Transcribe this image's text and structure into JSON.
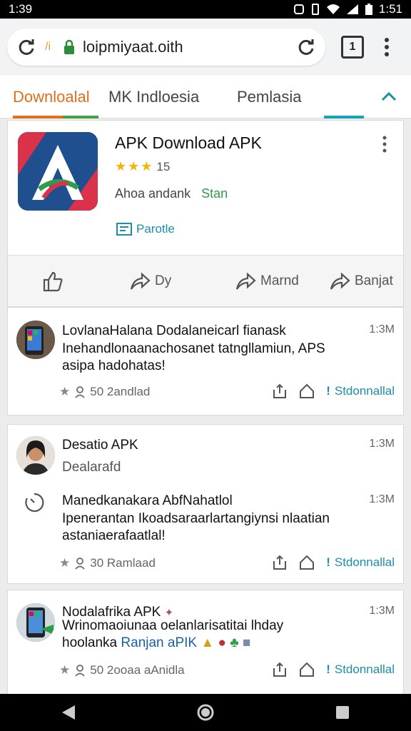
{
  "status_bar": {
    "time_left": "1:39",
    "time_right": "1:51"
  },
  "browser": {
    "url": "loipmiyaat.oith",
    "tab_count": "1",
    "lock_label": "/i"
  },
  "tabs": [
    {
      "label": "Downloalal"
    },
    {
      "label": "MK Indloesia"
    },
    {
      "label": "Pemlasia"
    }
  ],
  "app_card": {
    "title": "APK Download APK",
    "rating": "15",
    "subtitle": "Ahoa andank",
    "subtitle_status": "Stan",
    "badge_label": "Parotle",
    "actions": [
      {
        "label": ""
      },
      {
        "label": "Dy"
      },
      {
        "label": "Marnd"
      },
      {
        "label": "Banjat"
      }
    ]
  },
  "posts": [
    {
      "title": "LovlanaHalana Dodalaneicarl fianask",
      "body_lines": [
        "Inehandlonaanachosanet tatngllamiun, APS",
        "asipa hadohatas!"
      ],
      "time": "1:3M",
      "meta": "50 2andlad",
      "action_label": "Stdonnallal"
    },
    {
      "title": "Desatio APK",
      "subtitle": "Dealarafd",
      "time": "1:3M",
      "body_title": "Manedkanakara AbfNahatlol",
      "body_lines": [
        "Ipenerantan Ikoadsaraarlartangiynsi nlaatian",
        "astaniaerafaatlal!"
      ],
      "body_time": "1:3M",
      "meta": "30 Ramlaad",
      "action_label": "Stdonnallal"
    },
    {
      "title": "Nodalafrika APK",
      "body_lines": [
        "Wrinomaoiunaa oelanlarisatitai lhday",
        "hoolanka"
      ],
      "body_link": "Ranjan aPIK",
      "time": "1:3M",
      "meta": "50 2ooaa aAnidla",
      "action_label": "Stdonnallal"
    }
  ],
  "colors": {
    "accent_orange": "#e0701a",
    "accent_green": "#43a047",
    "accent_teal": "#1b8fa8",
    "star": "#f4b400"
  }
}
